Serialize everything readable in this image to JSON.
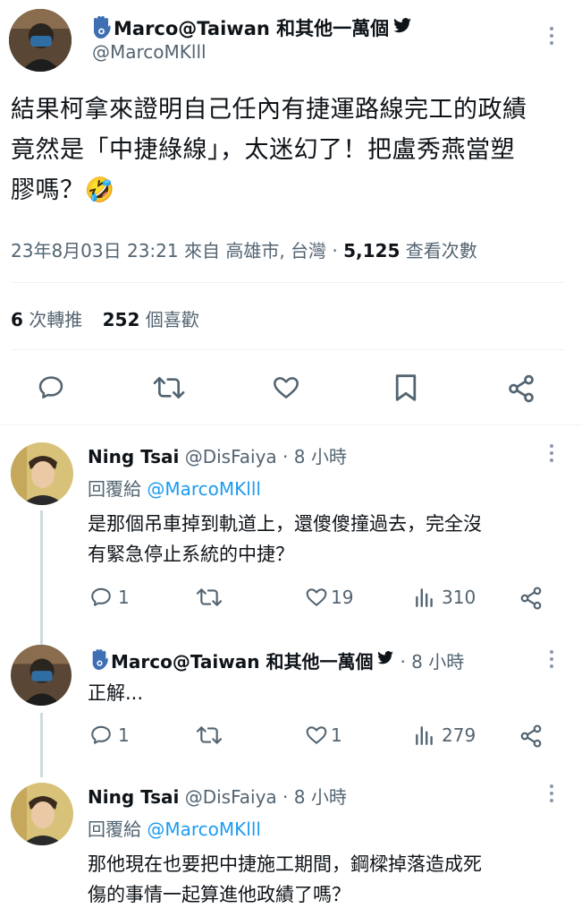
{
  "main_tweet": {
    "display_name": "Marco@Taiwan 和其他一萬個",
    "handle": "@MarcoMKlll",
    "text_line1": "結果柯拿來證明自己任內有捷運路線完工的政績",
    "text_line2": "竟然是「中捷綠線」，太迷幻了！把盧秀燕當塑",
    "text_line3": "膠嗎？🤣",
    "timestamp": "23年8月03日 23:21 來自 高雄市, 台灣",
    "separator": "·",
    "views_count": "5,125",
    "views_label": "查看次數",
    "retweets_count": "6",
    "retweets_label": "次轉推",
    "likes_count": "252",
    "likes_label": "個喜歡"
  },
  "replies": [
    {
      "display_name": "Ning Tsai",
      "handle": "@DisFaiya",
      "time": "· 8 小時",
      "reply_prefix": "回覆給",
      "reply_to": "@MarcoMKlll",
      "text_line1": "是那個吊車掉到軌道上，還傻傻撞過去，完全沒",
      "text_line2": "有緊急停止系統的中捷？",
      "reply_count": "1",
      "retweet_count": "",
      "like_count": "19",
      "view_count": "310"
    },
    {
      "display_name": "Marco@Taiwan 和其他一萬個",
      "time": "· 8 小時",
      "text_line1": "正解...",
      "reply_count": "1",
      "retweet_count": "",
      "like_count": "1",
      "view_count": "279"
    },
    {
      "display_name": "Ning Tsai",
      "handle": "@DisFaiya",
      "time": "· 8 小時",
      "reply_prefix": "回覆給",
      "reply_to": "@MarcoMKlll",
      "text_line1": "那他現在也要把中捷施工期間，鋼樑掉落造成死",
      "text_line2": "傷的事情一起算進他政績了嗎？"
    }
  ],
  "colors": {
    "accent": "#1d9bf0",
    "muted": "#536471",
    "text": "#0f1419",
    "divider": "#eff3f4"
  }
}
